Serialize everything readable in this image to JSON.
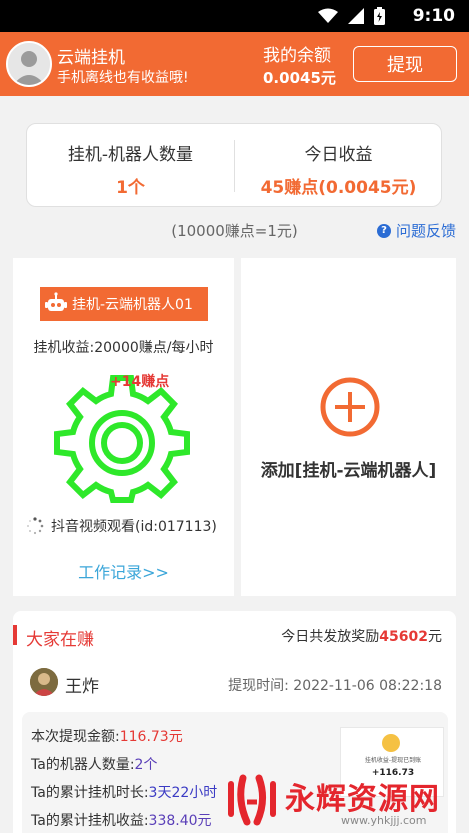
{
  "status_bar": {
    "time": "9:10"
  },
  "header": {
    "title": "云端挂机",
    "subtitle": "手机离线也有收益哦!",
    "balance_label": "我的余额",
    "balance_value": "0.0045元",
    "withdraw_label": "提现",
    "color": "#f26a33"
  },
  "stats": {
    "robots_label": "挂机-机器人数量",
    "robots_value": "1个",
    "today_label": "今日收益",
    "today_value": "45赚点(0.0045元)"
  },
  "rate_note": "(10000赚点=1元)",
  "feedback_label": "问题反馈",
  "robot": {
    "name": "挂机-云端机器人01",
    "income": "挂机收益:20000赚点/每小时",
    "earn_float": "+14赚点",
    "task": "抖音视频观看(id:017113)",
    "work_log": "工作记录>>"
  },
  "add_robot_label": "添加[挂机-云端机器人]",
  "earning_section": {
    "title": "大家在赚",
    "reward_prefix": "今日共发放奖励",
    "reward_amount": "45602",
    "reward_unit": "元",
    "user_name": "王炸",
    "withdraw_time_label": "提现时间:",
    "withdraw_time": "2022-11-06 08:22:18",
    "details": [
      {
        "label": "本次提现金额:",
        "value": "116.73元"
      },
      {
        "label": "Ta的机器人数量:",
        "value": "2个"
      },
      {
        "label": "Ta的累计挂机时长:",
        "value": "3天22小时"
      },
      {
        "label": "Ta的累计挂机收益:",
        "value": "338.40元"
      }
    ],
    "receipt_amount": "+116.73",
    "receipt_text": "挂机收益-提现已到账"
  },
  "watermark": {
    "name": "永辉资源网",
    "url": "www.yhkjjj.com"
  }
}
